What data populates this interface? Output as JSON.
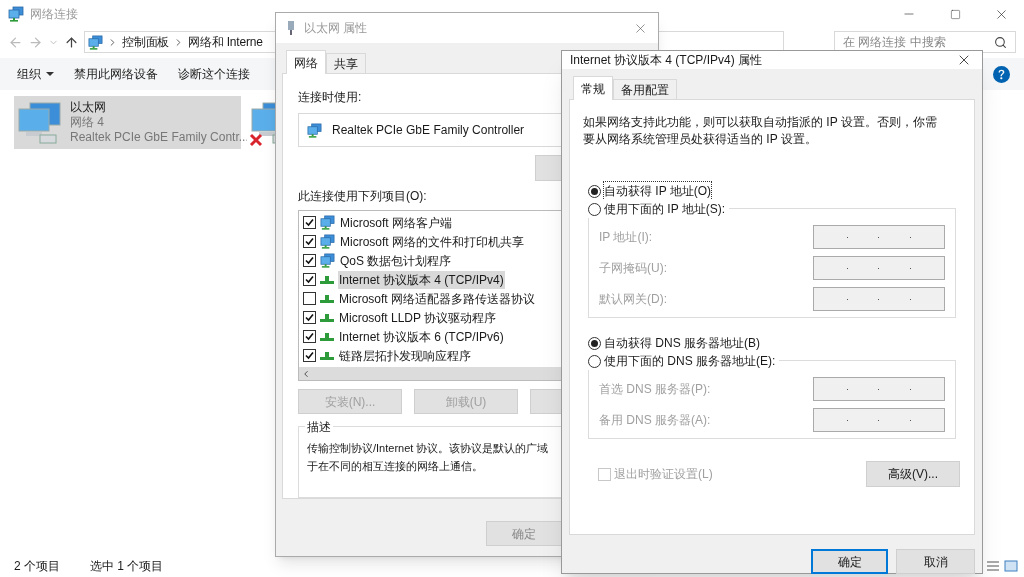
{
  "explorer": {
    "title": "网络连接",
    "breadcrumb": [
      "控制面板",
      "网络和 Interne"
    ],
    "search": {
      "placeholder": "在 网络连接 中搜索"
    },
    "toolbar": [
      {
        "label": "组织",
        "dropdown": true
      },
      {
        "label": "禁用此网络设备",
        "dropdown": false
      },
      {
        "label": "诊断这个连接",
        "dropdown": false
      }
    ],
    "connections": [
      {
        "name": "以太网",
        "network": "网络 4",
        "adapter": "Realtek PCIe GbE Family Contr...",
        "selected": true,
        "disconnected": false
      },
      {
        "selected": false,
        "disconnected": true
      }
    ],
    "status": {
      "count": "2 个项目",
      "selection": "选中 1 个项目"
    }
  },
  "ethernet_dialog": {
    "title": "以太网 属性",
    "tabs": [
      {
        "label": "网络",
        "selected": true
      },
      {
        "label": "共享",
        "selected": false
      }
    ],
    "connect_using_label": "连接时使用:",
    "adapter": "Realtek PCIe GbE Family Controller",
    "items_label": "此连接使用下列项目(O):",
    "items": [
      {
        "label": "Microsoft 网络客户端",
        "checked": true,
        "selected": false,
        "kind": "client"
      },
      {
        "label": "Microsoft 网络的文件和打印机共享",
        "checked": true,
        "selected": false,
        "kind": "client"
      },
      {
        "label": "QoS 数据包计划程序",
        "checked": true,
        "selected": false,
        "kind": "client"
      },
      {
        "label": "Internet 协议版本 4 (TCP/IPv4)",
        "checked": true,
        "selected": true,
        "kind": "protocol"
      },
      {
        "label": "Microsoft 网络适配器多路传送器协议",
        "checked": false,
        "selected": false,
        "kind": "protocol"
      },
      {
        "label": "Microsoft LLDP 协议驱动程序",
        "checked": true,
        "selected": false,
        "kind": "protocol"
      },
      {
        "label": "Internet 协议版本 6 (TCP/IPv6)",
        "checked": true,
        "selected": false,
        "kind": "protocol"
      },
      {
        "label": "链路层拓扑发现响应程序",
        "checked": true,
        "selected": false,
        "kind": "protocol"
      }
    ],
    "buttons": [
      {
        "label": "安装(N)...",
        "disabled": true
      },
      {
        "label": "卸载(U)",
        "disabled": true
      }
    ],
    "description_title": "描述",
    "description": [
      "传输控制协议/Internet 协议。该协议是默认的广域",
      "于在不同的相互连接的网络上通信。"
    ],
    "ok": "确定"
  },
  "ipv4_dialog": {
    "title": "Internet 协议版本 4 (TCP/IPv4) 属性",
    "tabs": [
      {
        "label": "常规",
        "selected": true
      },
      {
        "label": "备用配置",
        "selected": false
      }
    ],
    "intro": "如果网络支持此功能，则可以获取自动指派的 IP 设置。否则，你需要从网络系统管理员处获得适当的 IP 设置。",
    "ip_options": [
      {
        "label": "自动获得 IP 地址(O)",
        "selected": true
      },
      {
        "label": "使用下面的 IP 地址(S):",
        "selected": false
      }
    ],
    "ip_fields": [
      {
        "label": "IP 地址(I):",
        "disabled": true
      },
      {
        "label": "子网掩码(U):",
        "disabled": true
      },
      {
        "label": "默认网关(D):",
        "disabled": true
      }
    ],
    "dns_options": [
      {
        "label": "自动获得 DNS 服务器地址(B)",
        "selected": true
      },
      {
        "label": "使用下面的 DNS 服务器地址(E):",
        "selected": false
      }
    ],
    "dns_fields": [
      {
        "label": "首选 DNS 服务器(P):",
        "disabled": true
      },
      {
        "label": "备用 DNS 服务器(A):",
        "disabled": true
      }
    ],
    "validate": {
      "label": "退出时验证设置(L)",
      "checked": false,
      "disabled": true
    },
    "advanced": "高级(V)...",
    "ok": "确定",
    "cancel": "取消"
  }
}
